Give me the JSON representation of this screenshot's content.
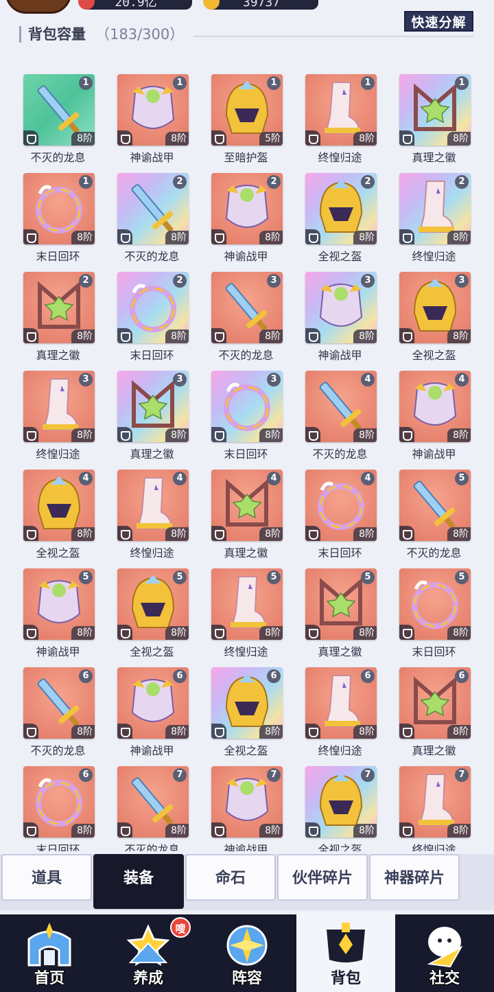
{
  "topbar": {
    "gold": "20.9亿",
    "gems": "39737"
  },
  "quick_decompose_label": "快速分解",
  "capacity": {
    "title": "背包容量",
    "count": "（183/300）"
  },
  "items": [
    {
      "name": "不灭的龙息",
      "level": "1",
      "tier": "8阶",
      "kind": "sword",
      "bg": "green"
    },
    {
      "name": "神谕战甲",
      "level": "1",
      "tier": "8阶",
      "kind": "armor",
      "bg": "red"
    },
    {
      "name": "至暗护盔",
      "level": "1",
      "tier": "5阶",
      "kind": "helm",
      "bg": "red"
    },
    {
      "name": "终惶归途",
      "level": "1",
      "tier": "8阶",
      "kind": "boot",
      "bg": "red"
    },
    {
      "name": "真理之徽",
      "level": "1",
      "tier": "8阶",
      "kind": "emblem",
      "bg": "rainbow"
    },
    {
      "name": "末日回环",
      "level": "1",
      "tier": "8阶",
      "kind": "ring",
      "bg": "red"
    },
    {
      "name": "不灭的龙息",
      "level": "2",
      "tier": "8阶",
      "kind": "sword",
      "bg": "rainbow"
    },
    {
      "name": "神谕战甲",
      "level": "2",
      "tier": "8阶",
      "kind": "armor",
      "bg": "red"
    },
    {
      "name": "全视之盔",
      "level": "2",
      "tier": "8阶",
      "kind": "helm",
      "bg": "rainbow"
    },
    {
      "name": "终惶归途",
      "level": "2",
      "tier": "8阶",
      "kind": "boot",
      "bg": "rainbow"
    },
    {
      "name": "真理之徽",
      "level": "2",
      "tier": "8阶",
      "kind": "emblem",
      "bg": "red"
    },
    {
      "name": "末日回环",
      "level": "2",
      "tier": "8阶",
      "kind": "ring",
      "bg": "rainbow"
    },
    {
      "name": "不灭的龙息",
      "level": "3",
      "tier": "8阶",
      "kind": "sword",
      "bg": "red"
    },
    {
      "name": "神谕战甲",
      "level": "3",
      "tier": "8阶",
      "kind": "armor",
      "bg": "rainbow"
    },
    {
      "name": "全视之盔",
      "level": "3",
      "tier": "8阶",
      "kind": "helm",
      "bg": "red"
    },
    {
      "name": "终惶归途",
      "level": "3",
      "tier": "8阶",
      "kind": "boot",
      "bg": "red"
    },
    {
      "name": "真理之徽",
      "level": "3",
      "tier": "8阶",
      "kind": "emblem",
      "bg": "rainbow"
    },
    {
      "name": "末日回环",
      "level": "3",
      "tier": "8阶",
      "kind": "ring",
      "bg": "rainbow"
    },
    {
      "name": "不灭的龙息",
      "level": "4",
      "tier": "8阶",
      "kind": "sword",
      "bg": "red"
    },
    {
      "name": "神谕战甲",
      "level": "4",
      "tier": "8阶",
      "kind": "armor",
      "bg": "red"
    },
    {
      "name": "全视之盔",
      "level": "4",
      "tier": "8阶",
      "kind": "helm",
      "bg": "red"
    },
    {
      "name": "终惶归途",
      "level": "4",
      "tier": "8阶",
      "kind": "boot",
      "bg": "red"
    },
    {
      "name": "真理之徽",
      "level": "4",
      "tier": "8阶",
      "kind": "emblem",
      "bg": "red"
    },
    {
      "name": "末日回环",
      "level": "4",
      "tier": "8阶",
      "kind": "ring",
      "bg": "red"
    },
    {
      "name": "不灭的龙息",
      "level": "5",
      "tier": "8阶",
      "kind": "sword",
      "bg": "red"
    },
    {
      "name": "神谕战甲",
      "level": "5",
      "tier": "8阶",
      "kind": "armor",
      "bg": "red"
    },
    {
      "name": "全视之盔",
      "level": "5",
      "tier": "8阶",
      "kind": "helm",
      "bg": "red"
    },
    {
      "name": "终惶归途",
      "level": "5",
      "tier": "8阶",
      "kind": "boot",
      "bg": "red"
    },
    {
      "name": "真理之徽",
      "level": "5",
      "tier": "8阶",
      "kind": "emblem",
      "bg": "red"
    },
    {
      "name": "末日回环",
      "level": "5",
      "tier": "8阶",
      "kind": "ring",
      "bg": "red"
    },
    {
      "name": "不灭的龙息",
      "level": "6",
      "tier": "8阶",
      "kind": "sword",
      "bg": "red"
    },
    {
      "name": "神谕战甲",
      "level": "6",
      "tier": "8阶",
      "kind": "armor",
      "bg": "red"
    },
    {
      "name": "全视之盔",
      "level": "6",
      "tier": "8阶",
      "kind": "helm",
      "bg": "rainbow"
    },
    {
      "name": "终惶归途",
      "level": "6",
      "tier": "8阶",
      "kind": "boot",
      "bg": "red"
    },
    {
      "name": "真理之徽",
      "level": "6",
      "tier": "8阶",
      "kind": "emblem",
      "bg": "red"
    },
    {
      "name": "末日回环",
      "level": "6",
      "tier": "8阶",
      "kind": "ring",
      "bg": "red"
    },
    {
      "name": "不灭的龙息",
      "level": "7",
      "tier": "8阶",
      "kind": "sword",
      "bg": "red"
    },
    {
      "name": "神谕战甲",
      "level": "7",
      "tier": "8阶",
      "kind": "armor",
      "bg": "red"
    },
    {
      "name": "全视之盔",
      "level": "7",
      "tier": "8阶",
      "kind": "helm",
      "bg": "rainbow"
    },
    {
      "name": "终惶归途",
      "level": "7",
      "tier": "8阶",
      "kind": "boot",
      "bg": "red"
    }
  ],
  "tabs": [
    {
      "label": "道具"
    },
    {
      "label": "装备",
      "active": true
    },
    {
      "label": "命石"
    },
    {
      "label": "伙伴碎片"
    },
    {
      "label": "神器碎片"
    }
  ],
  "nav": [
    {
      "label": "首页",
      "icon": "castle-icon"
    },
    {
      "label": "养成",
      "icon": "star-icon",
      "dot": "嗖"
    },
    {
      "label": "阵容",
      "icon": "compass-icon"
    },
    {
      "label": "背包",
      "icon": "bag-icon",
      "active": true
    },
    {
      "label": "社交",
      "icon": "chat-icon"
    }
  ],
  "colors": {
    "card_red": "#e88571",
    "card_green": "#4ec39a",
    "nav_bg": "#171a2c",
    "tab_active": "#17182a"
  }
}
